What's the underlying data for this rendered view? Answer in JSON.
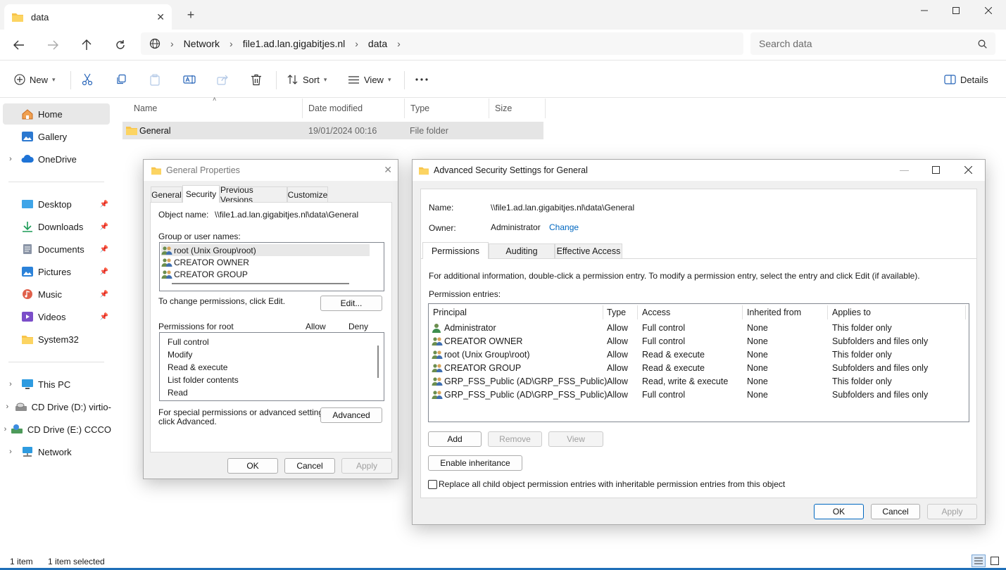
{
  "explorer": {
    "tab_title": "data",
    "breadcrumb": [
      "Network",
      "file1.ad.lan.gigabitjes.nl",
      "data"
    ],
    "search_placeholder": "Search data",
    "toolbar": {
      "new_label": "New",
      "sort_label": "Sort",
      "view_label": "View",
      "details_label": "Details"
    },
    "sidebar": {
      "home": "Home",
      "gallery": "Gallery",
      "onedrive": "OneDrive",
      "desktop": "Desktop",
      "downloads": "Downloads",
      "documents": "Documents",
      "pictures": "Pictures",
      "music": "Music",
      "videos": "Videos",
      "system32": "System32",
      "this_pc": "This PC",
      "cd_d": "CD Drive (D:) virtio-",
      "cd_e": "CD Drive (E:) CCCO",
      "network": "Network"
    },
    "columns": {
      "name": "Name",
      "date": "Date modified",
      "type": "Type",
      "size": "Size"
    },
    "file": {
      "name": "General",
      "date": "19/01/2024 00:16",
      "type": "File folder"
    },
    "status": {
      "items": "1 item",
      "selected": "1 item selected"
    }
  },
  "properties": {
    "title": "General Properties",
    "tabs": [
      "General",
      "Security",
      "Previous Versions",
      "Customize"
    ],
    "object_name_label": "Object name:",
    "object_name_value": "\\\\file1.ad.lan.gigabitjes.nl\\data\\General",
    "group_label": "Group or user names:",
    "groups": [
      "root (Unix Group\\root)",
      "CREATOR OWNER",
      "CREATOR GROUP"
    ],
    "change_text": "To change permissions, click Edit.",
    "edit_button": "Edit...",
    "permissions_for": "Permissions for root",
    "allow_header": "Allow",
    "deny_header": "Deny",
    "permissions": [
      "Full control",
      "Modify",
      "Read & execute",
      "List folder contents",
      "Read"
    ],
    "special_text_1": "For special permissions or advanced settings,",
    "special_text_2": "click Advanced.",
    "advanced_button": "Advanced",
    "ok": "OK",
    "cancel": "Cancel",
    "apply": "Apply"
  },
  "advanced": {
    "title": "Advanced Security Settings for General",
    "name_label": "Name:",
    "name_value": "\\\\file1.ad.lan.gigabitjes.nl\\data\\General",
    "owner_label": "Owner:",
    "owner_value": "Administrator",
    "change_link": "Change",
    "tabs": [
      "Permissions",
      "Auditing",
      "Effective Access"
    ],
    "info_text": "For additional information, double-click a permission entry. To modify a permission entry, select the entry and click Edit (if available).",
    "entries_label": "Permission entries:",
    "headers": [
      "Principal",
      "Type",
      "Access",
      "Inherited from",
      "Applies to"
    ],
    "entries": [
      {
        "principal": "Administrator",
        "type": "Allow",
        "access": "Full control",
        "inherited": "None",
        "applies": "This folder only"
      },
      {
        "principal": "CREATOR OWNER",
        "type": "Allow",
        "access": "Full control",
        "inherited": "None",
        "applies": "Subfolders and files only"
      },
      {
        "principal": "root (Unix Group\\root)",
        "type": "Allow",
        "access": "Read & execute",
        "inherited": "None",
        "applies": "This folder only"
      },
      {
        "principal": "CREATOR GROUP",
        "type": "Allow",
        "access": "Read & execute",
        "inherited": "None",
        "applies": "Subfolders and files only"
      },
      {
        "principal": "GRP_FSS_Public (AD\\GRP_FSS_Public)",
        "type": "Allow",
        "access": "Read, write & execute",
        "inherited": "None",
        "applies": "This folder only"
      },
      {
        "principal": "GRP_FSS_Public (AD\\GRP_FSS_Public)",
        "type": "Allow",
        "access": "Full control",
        "inherited": "None",
        "applies": "Subfolders and files only"
      }
    ],
    "add_button": "Add",
    "remove_button": "Remove",
    "view_button": "View",
    "enable_inheritance": "Enable inheritance",
    "replace_text": "Replace all child object permission entries with inheritable permission entries from this object",
    "ok": "OK",
    "cancel": "Cancel",
    "apply": "Apply"
  }
}
